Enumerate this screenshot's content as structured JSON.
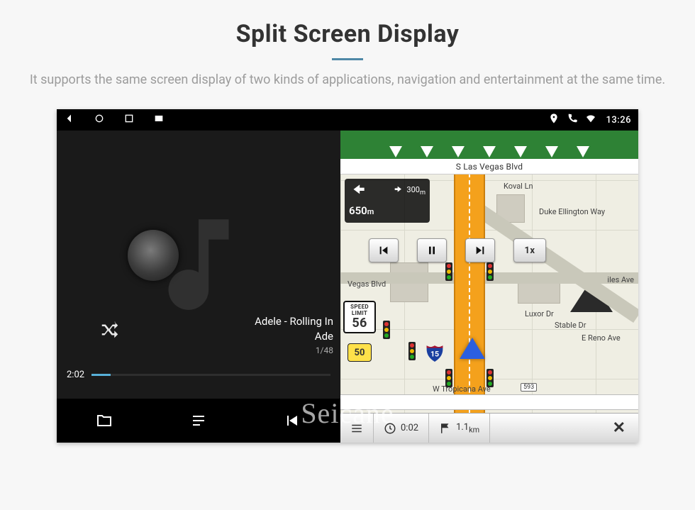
{
  "page": {
    "title": "Split Screen Display",
    "subtitle": "It supports the same screen display of two kinds of applications, navigation and entertainment at the same time."
  },
  "statusbar": {
    "time": "13:26"
  },
  "player": {
    "track_line1": "Adele - Rolling In",
    "track_line2": "Ade",
    "track_counter": "1/48",
    "elapsed": "2:02"
  },
  "nav": {
    "street_top": "S Las Vegas Blvd",
    "turn": {
      "next_dist_value": "300",
      "next_dist_unit": "m",
      "main_dist_value": "650",
      "main_dist_unit": "m"
    },
    "speed_limit_label": "SPEED LIMIT",
    "speed_limit_value": "56",
    "route_shield": "50",
    "interstate": "15",
    "playback_speed": "1x",
    "labels": {
      "vegas_blvd": "Vegas Blvd",
      "koval_ln": "Koval Ln",
      "duke_ellington": "Duke Ellington Way",
      "luxor": "Luxor Dr",
      "stable": "Stable Dr",
      "reno": "E Reno Ave",
      "tropicana": "W Tropicana Ave",
      "badge": "593"
    },
    "bottom": {
      "eta_value": "0:02",
      "dist_value": "1.1",
      "dist_unit": "km"
    }
  },
  "watermark": "Seicane"
}
